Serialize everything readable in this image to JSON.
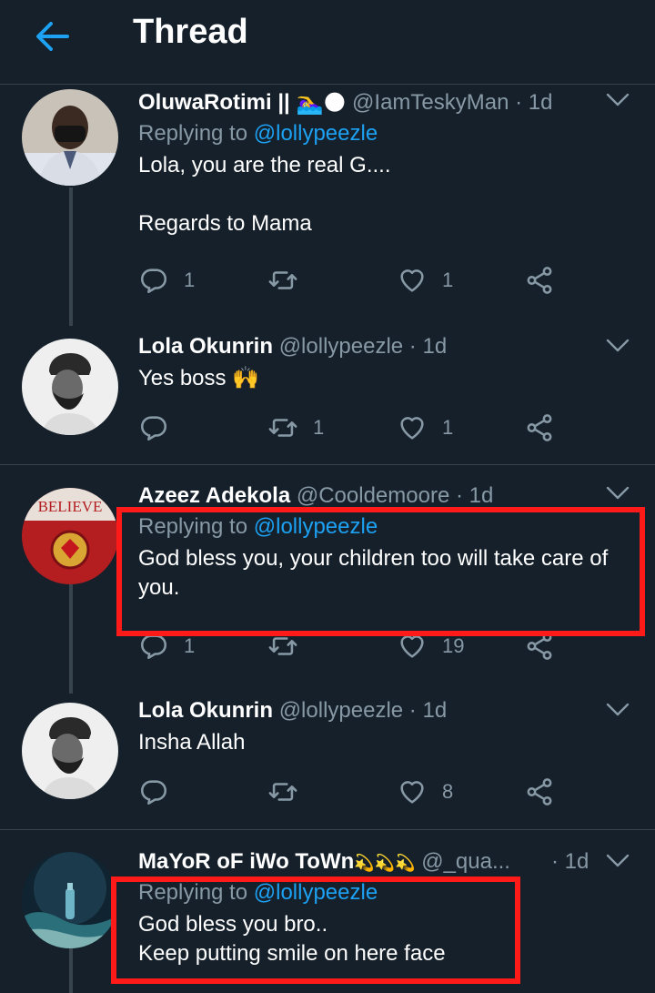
{
  "header": {
    "title": "Thread"
  },
  "tweets": [
    {
      "name": "OluwaRotimi ||",
      "name_emoji": "🏊‍♀️🌑",
      "handle": "@IamTeskyMan",
      "time": "1d",
      "reply_prefix": "Replying to",
      "reply_mention": "@lollypeezle",
      "text": "Lola, you are the real G....\n\nRegards to Mama",
      "replies": "1",
      "retweets": "",
      "likes": "1"
    },
    {
      "name": "Lola Okunrin",
      "handle": "@lollypeezle",
      "time": "1d",
      "text": "Yes boss 🙌",
      "replies": "",
      "retweets": "1",
      "likes": "1"
    },
    {
      "name": "Azeez Adekola",
      "handle": "@Cooldemoore",
      "time": "1d",
      "reply_prefix": "Replying to",
      "reply_mention": "@lollypeezle",
      "text": "God bless you, your children too will take care of you.",
      "replies": "1",
      "retweets": "",
      "likes": "19",
      "avatar_text": "BELIEVE"
    },
    {
      "name": "Lola Okunrin",
      "handle": "@lollypeezle",
      "time": "1d",
      "text": "Insha Allah",
      "replies": "",
      "retweets": "",
      "likes": "8"
    },
    {
      "name": "MaYoR oF iWo ToWn",
      "name_emoji": "💫💫💫",
      "handle": "@_qua...",
      "time": "1d",
      "reply_prefix": "Replying to",
      "reply_mention": "@lollypeezle",
      "text": "God bless you bro..\nKeep putting smile on here face"
    }
  ],
  "colors": {
    "background": "#15202b",
    "accent": "#1da1f2",
    "muted": "#8899a6",
    "highlight": "#ff1a1a"
  },
  "icons": [
    "back-arrow-icon",
    "chevron-down-icon",
    "reply-icon",
    "retweet-icon",
    "like-icon",
    "share-icon"
  ]
}
